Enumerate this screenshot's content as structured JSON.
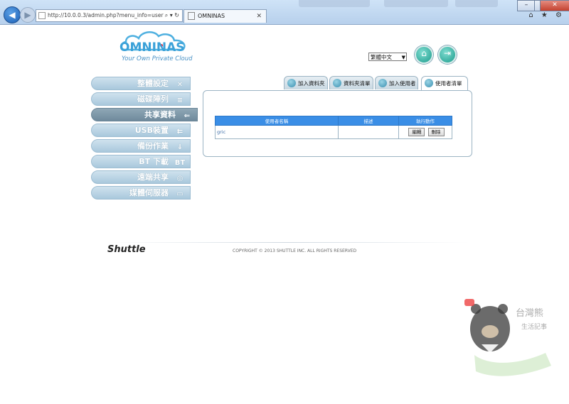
{
  "browser": {
    "url": "http://10.0.0.3/admin.php?menu_info=user",
    "tab_title": "OMNINAS",
    "tab_close": "✕",
    "addr_tools": "⌕ ▾ ↻",
    "right_icons": "⌂ ★ ⚙",
    "min": "–",
    "max": "□",
    "close": "✕"
  },
  "brand": {
    "logo_text": "OMNINAS",
    "tagline": "Your Own Private Cloud"
  },
  "header": {
    "language": "繁體中文",
    "home_icon": "⌂",
    "logout_icon": "⇥"
  },
  "sidebar": {
    "items": [
      {
        "label": "整體設定",
        "icon": "✕"
      },
      {
        "label": "磁碟陣列",
        "icon": "≡"
      },
      {
        "label": "共享資料",
        "icon": "⇐"
      },
      {
        "label": "USB裝置",
        "icon": "⇇"
      },
      {
        "label": "備份作業",
        "icon": "⇓"
      },
      {
        "label": "BT 下載",
        "icon": "BT"
      },
      {
        "label": "遠端共享",
        "icon": "◎"
      },
      {
        "label": "媒體伺服器",
        "icon": "▭"
      }
    ],
    "active_index": 2
  },
  "tabs": [
    "加入資料夾",
    "資料夾清單",
    "加入使用者",
    "使用者清單"
  ],
  "active_tab": 3,
  "table": {
    "headers": [
      "使用者名稱",
      "描述",
      "執行動作"
    ],
    "rows": [
      {
        "name": "gric",
        "description": "",
        "actions": [
          "編輯",
          "刪除"
        ]
      }
    ]
  },
  "footer": {
    "brand": "Shuttle",
    "copyright": "COPYRIGHT © 2013 SHUTTLE INC.  ALL RIGHTS RESERVED"
  },
  "colors": {
    "accent": "#3a8ee6",
    "sidebar": "#a9c8dc",
    "sidebar_active": "#6f8a9c",
    "logo": "#3aa1d8"
  }
}
